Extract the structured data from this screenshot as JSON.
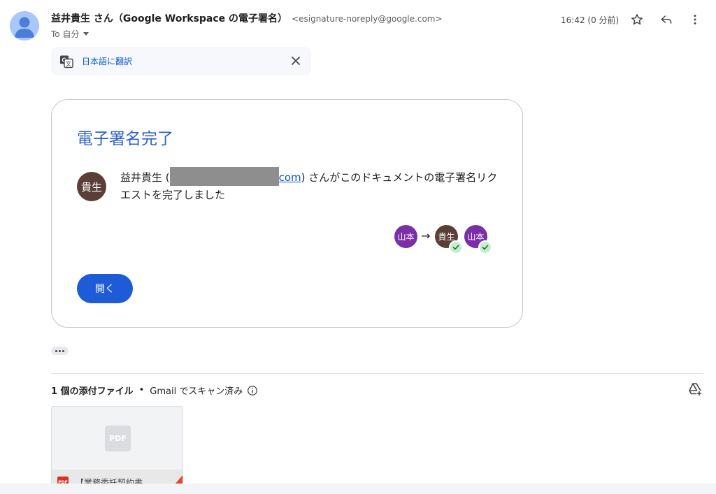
{
  "sender": {
    "name": "益井貴生 さん（Google Workspace の電子署名）",
    "email": "<esignature-noreply@google.com>",
    "to_label": "To 自分"
  },
  "time": "16:42 (0 分前)",
  "icons": {
    "star": "star-icon",
    "reply": "reply-icon",
    "more": "more-vert-icon",
    "translate": "translate-icon",
    "close": "close-icon",
    "info": "info-icon",
    "drive_add": "add-to-drive-icon",
    "check": "check-icon"
  },
  "translate_bar": {
    "label": "日本語に翻訳"
  },
  "card": {
    "title": "電子署名完了",
    "signer_initials": "貴生",
    "message_prefix": "益井貴生 (",
    "email_tail": "com",
    "message_suffix": ") さんがこのドキュメントの電子署名リクエストを完了しました",
    "chain": {
      "first": "山本",
      "arrow": "→",
      "second": "貴生",
      "third": "山本"
    },
    "open_button": "開く"
  },
  "attachments": {
    "count_label": "1 個の添付ファイル",
    "separator": "•",
    "scan_label": "Gmail でスキャン済み",
    "thumb_label": "PDF",
    "file_badge": "PDF",
    "file_name": "【業務委託契約書..."
  },
  "colors": {
    "title_blue": "#2f5fc9",
    "button_blue": "#1e5bd6",
    "link_blue": "#0b57d0",
    "purple_avatar": "#7b2ea6",
    "brown_avatar": "#5b3f37",
    "check_green": "#c4eed0"
  }
}
